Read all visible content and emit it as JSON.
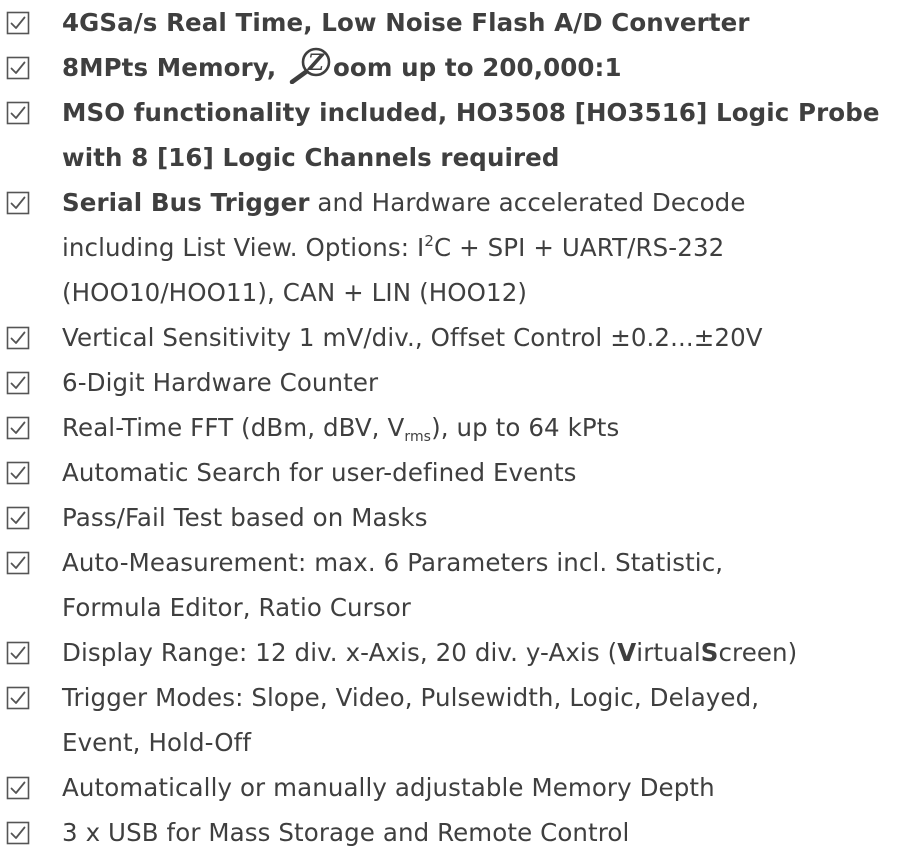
{
  "features": [
    {
      "lines": [
        [
          {
            "text": "4GSa/s Real Time, Low Noise Flash A/D Converter",
            "style": "bold"
          }
        ]
      ]
    },
    {
      "lines": [
        [
          {
            "text": "8MPts Memory, ",
            "style": "bold"
          },
          {
            "icon": "zoom-magnifier-icon"
          },
          {
            "text": "oom up to 200,000:1",
            "style": "bold"
          }
        ]
      ]
    },
    {
      "lines": [
        [
          {
            "text": "MSO functionality included, HO3508 [HO3516] Logic Probe",
            "style": "bold"
          }
        ],
        [
          {
            "text": "with 8 [16] Logic Channels required",
            "style": "bold"
          }
        ]
      ]
    },
    {
      "lines": [
        [
          {
            "text": "Serial Bus Trigger",
            "style": "bold"
          },
          {
            "text": " and Hardware accelerated Decode",
            "style": "normal"
          }
        ],
        [
          {
            "text": "including List View. Options: I",
            "style": "normal"
          },
          {
            "text": "2",
            "style": "sup"
          },
          {
            "text": "C + SPI + UART/RS-232",
            "style": "normal"
          }
        ],
        [
          {
            "text": "(HOO10/HOO11), CAN + LIN (HOO12)",
            "style": "normal"
          }
        ]
      ]
    },
    {
      "lines": [
        [
          {
            "text": "Vertical Sensitivity 1 mV/div., Offset Control ±0.2...±20V",
            "style": "normal"
          }
        ]
      ]
    },
    {
      "lines": [
        [
          {
            "text": "6-Digit Hardware Counter",
            "style": "normal"
          }
        ]
      ]
    },
    {
      "lines": [
        [
          {
            "text": "Real-Time FFT (dBm, dBV, V",
            "style": "normal"
          },
          {
            "text": "rms",
            "style": "sub"
          },
          {
            "text": "), up to 64 kPts",
            "style": "normal"
          }
        ]
      ]
    },
    {
      "lines": [
        [
          {
            "text": "Automatic Search for user-defined Events",
            "style": "normal"
          }
        ]
      ]
    },
    {
      "lines": [
        [
          {
            "text": "Pass/Fail Test based on Masks",
            "style": "normal"
          }
        ]
      ]
    },
    {
      "lines": [
        [
          {
            "text": "Auto-Measurement: max. 6 Parameters incl. Statistic,",
            "style": "normal"
          }
        ],
        [
          {
            "text": "Formula Editor, Ratio Cursor",
            "style": "normal"
          }
        ]
      ]
    },
    {
      "lines": [
        [
          {
            "text": "Display Range: 12 div. x-Axis, 20 div. y-Axis (",
            "style": "normal"
          },
          {
            "text": "V",
            "style": "bold"
          },
          {
            "text": "irtual",
            "style": "normal"
          },
          {
            "text": "S",
            "style": "bold"
          },
          {
            "text": "creen)",
            "style": "normal"
          }
        ]
      ]
    },
    {
      "lines": [
        [
          {
            "text": "Trigger Modes: Slope, Video, Pulsewidth, Logic, Delayed,",
            "style": "normal"
          }
        ],
        [
          {
            "text": "Event, Hold-Off",
            "style": "normal"
          }
        ]
      ]
    },
    {
      "lines": [
        [
          {
            "text": "Automatically or manually adjustable Memory Depth",
            "style": "normal"
          }
        ]
      ]
    },
    {
      "lines": [
        [
          {
            "text": "3 x USB for Mass Storage and Remote Control",
            "style": "normal"
          }
        ]
      ]
    }
  ],
  "icons": {
    "check": "checkbox-checked-icon",
    "zoom_letter": "Z"
  },
  "colors": {
    "text": "#3f3f3f",
    "checkbox": "#555555"
  }
}
